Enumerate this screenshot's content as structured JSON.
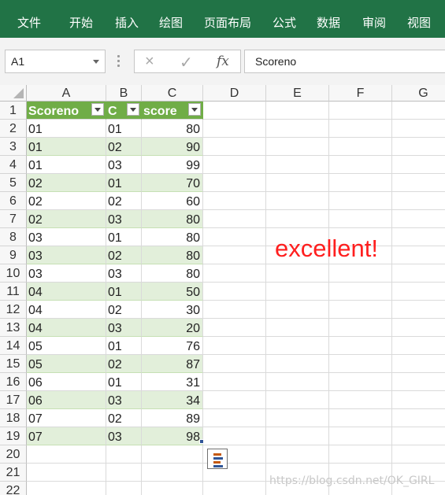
{
  "ribbon": {
    "tabs": [
      "文件",
      "开始",
      "插入",
      "绘图",
      "页面布局",
      "公式",
      "数据",
      "审阅",
      "视图"
    ]
  },
  "formula_bar": {
    "name_box": "A1",
    "cancel_icon": "×",
    "enter_icon": "✓",
    "fx_label": "fx",
    "formula_value": "Scoreno"
  },
  "columns": [
    "A",
    "B",
    "C",
    "D",
    "E",
    "F",
    "G"
  ],
  "rows": [
    "1",
    "2",
    "3",
    "4",
    "5",
    "6",
    "7",
    "8",
    "9",
    "10",
    "11",
    "12",
    "13",
    "14",
    "15",
    "16",
    "17",
    "18",
    "19",
    "20",
    "21",
    "22"
  ],
  "table": {
    "headers": [
      "Scoreno",
      "C",
      "score"
    ],
    "rows": [
      [
        "01",
        "01",
        "80"
      ],
      [
        "01",
        "02",
        "90"
      ],
      [
        "01",
        "03",
        "99"
      ],
      [
        "02",
        "01",
        "70"
      ],
      [
        "02",
        "02",
        "60"
      ],
      [
        "02",
        "03",
        "80"
      ],
      [
        "03",
        "01",
        "80"
      ],
      [
        "03",
        "02",
        "80"
      ],
      [
        "03",
        "03",
        "80"
      ],
      [
        "04",
        "01",
        "50"
      ],
      [
        "04",
        "02",
        "30"
      ],
      [
        "04",
        "03",
        "20"
      ],
      [
        "05",
        "01",
        "76"
      ],
      [
        "05",
        "02",
        "87"
      ],
      [
        "06",
        "01",
        "31"
      ],
      [
        "06",
        "03",
        "34"
      ],
      [
        "07",
        "02",
        "89"
      ],
      [
        "07",
        "03",
        "98"
      ]
    ]
  },
  "annotation": {
    "text": "excellent!",
    "color": "#ff1f1f"
  },
  "watermark": "https://blog.csdn.net/OK_GIRL",
  "colors": {
    "ribbon": "#217346",
    "table_header": "#70ad47",
    "band": "#e2efda"
  }
}
